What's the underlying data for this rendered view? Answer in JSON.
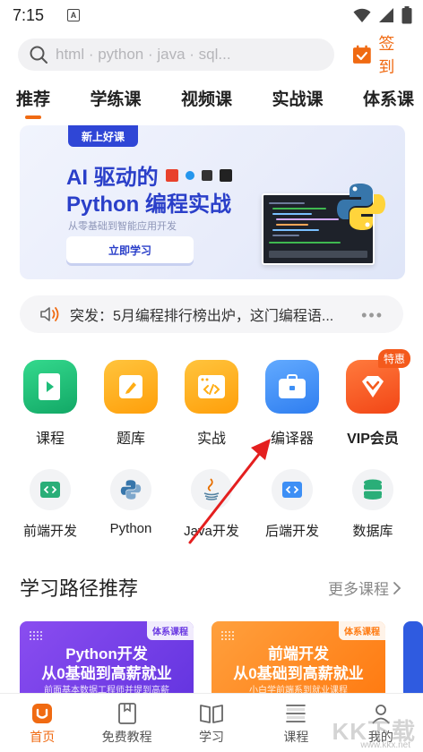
{
  "status": {
    "time": "7:15",
    "notif": "A"
  },
  "search": {
    "placeholder": "html · python · java · sql..."
  },
  "signin": {
    "label": "签到"
  },
  "tabs": [
    {
      "label": "推荐",
      "active": true
    },
    {
      "label": "学练课"
    },
    {
      "label": "视频课"
    },
    {
      "label": "实战课"
    },
    {
      "label": "体系课"
    }
  ],
  "banner": {
    "tag": "新上好课",
    "line1": "AI 驱动的",
    "line2": "Python 编程实战",
    "subtitle": "从零基础到智能应用开发",
    "button": "立即学习"
  },
  "notice": {
    "text": "突发：5月编程排行榜出炉，这门编程语...",
    "more": "•••"
  },
  "main_items": [
    {
      "label": "课程",
      "icon": "play-book-icon",
      "color": "#1fbd7a"
    },
    {
      "label": "题库",
      "icon": "pencil-note-icon",
      "color": "#ffad14"
    },
    {
      "label": "实战",
      "icon": "code-window-icon",
      "color": "#ffad14"
    },
    {
      "label": "编译器",
      "icon": "toolbox-icon",
      "color": "#3d8ff5"
    },
    {
      "label": "VIP会员",
      "icon": "vip-diamond-icon",
      "color": "#f45a1c",
      "badge": "特惠"
    }
  ],
  "sub_items": [
    {
      "label": "前端开发",
      "icon": "frontend-icon"
    },
    {
      "label": "Python",
      "icon": "python-icon"
    },
    {
      "label": "Java开发",
      "icon": "java-icon"
    },
    {
      "label": "后端开发",
      "icon": "backend-icon"
    },
    {
      "label": "数据库",
      "icon": "database-icon"
    }
  ],
  "section": {
    "title": "学习路径推荐",
    "more": "更多课程"
  },
  "cards": [
    {
      "tag": "体系课程",
      "line1": "Python开发",
      "line2": "从0基础到高薪就业",
      "line3": "前面基本数据工程师并提到高薪",
      "color": "#7b45e8"
    },
    {
      "tag": "体系课程",
      "line1": "前端开发",
      "line2": "从0基础到高薪就业",
      "line3": "小白学前端系到就业课程",
      "color": "#ff8a1c"
    }
  ],
  "bottom_nav": [
    {
      "label": "首页",
      "active": true
    },
    {
      "label": "免费教程"
    },
    {
      "label": "学习"
    },
    {
      "label": "课程"
    },
    {
      "label": "我的"
    }
  ],
  "watermark": {
    "text": "KK下载",
    "sub": "www.kkx.net"
  },
  "colors": {
    "accent": "#f06a12",
    "banner_blue": "#2a3fc9"
  }
}
